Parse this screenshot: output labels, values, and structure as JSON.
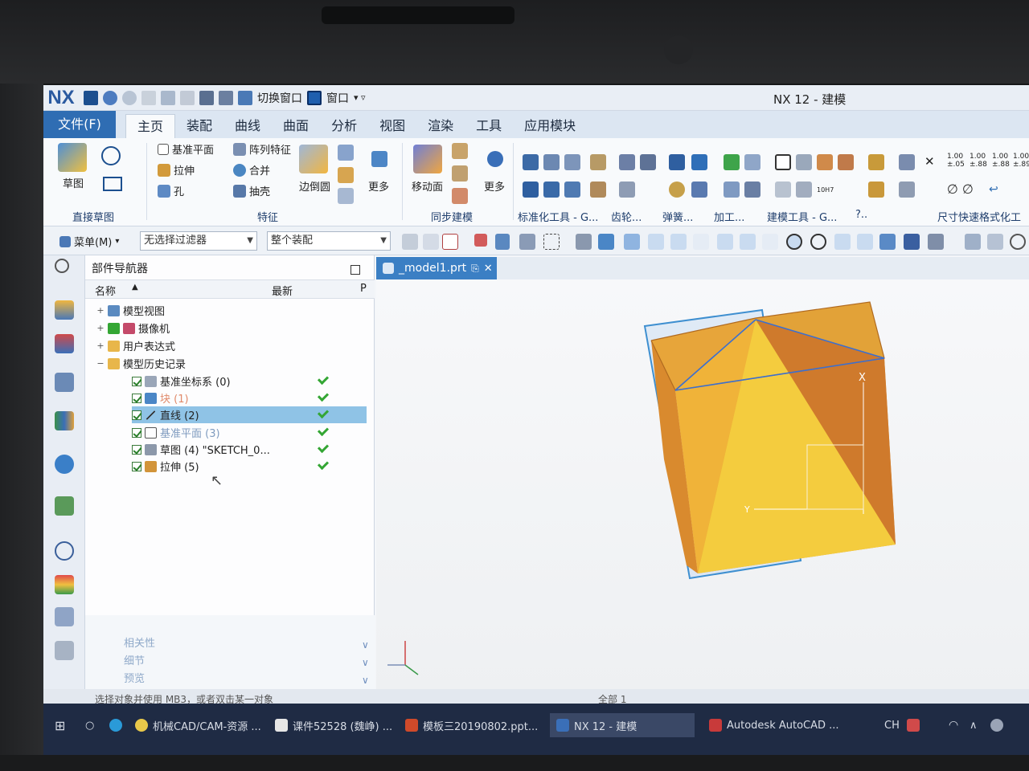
{
  "window": {
    "app_logo": "NX",
    "title": "NX 12 - 建模"
  },
  "quick_access": {
    "switch_window": "切换窗口",
    "window_menu": "窗口"
  },
  "tabs": [
    {
      "label": "文件(F)",
      "name": "tab-file"
    },
    {
      "label": "主页",
      "name": "tab-home"
    },
    {
      "label": "装配",
      "name": "tab-assembly"
    },
    {
      "label": "曲线",
      "name": "tab-curve"
    },
    {
      "label": "曲面",
      "name": "tab-surface"
    },
    {
      "label": "分析",
      "name": "tab-analysis"
    },
    {
      "label": "视图",
      "name": "tab-view"
    },
    {
      "label": "渲染",
      "name": "tab-render"
    },
    {
      "label": "工具",
      "name": "tab-tools"
    },
    {
      "label": "应用模块",
      "name": "tab-applications"
    }
  ],
  "ribbon": {
    "sketch": "草图",
    "direct_sketch_group": "直接草图",
    "datum_plane": "基准平面",
    "extrude": "拉伸",
    "hole": "孔",
    "pattern_feature": "阵列特征",
    "unite": "合并",
    "shell": "抽壳",
    "edge_blend": "边倒圆",
    "more": "更多",
    "feature_group": "特征",
    "move_face": "移动面",
    "more2": "更多",
    "sync_group": "同步建模",
    "std_tools": "标准化工具 - G...",
    "gear": "齿轮...",
    "spring": "弹簧...",
    "machining": "加工...",
    "build_tools": "建模工具 - G...",
    "q": "?..",
    "dim_format": "尺寸快速格式化工具",
    "dim_values": [
      "1.00\n±.05",
      "1.00\n±.88",
      "1.00\n±.88",
      "1.00\n±.89"
    ],
    "tol_label": "10H7"
  },
  "filterbar": {
    "menu": "菜单(M)",
    "filter": "无选择过滤器",
    "scope": "整个装配"
  },
  "navigator": {
    "title": "部件导航器",
    "col_name": "名称",
    "col_latest": "最新",
    "col_p": "P",
    "nodes": [
      {
        "label": "模型视图"
      },
      {
        "label": "摄像机"
      },
      {
        "label": "用户表达式"
      },
      {
        "label": "模型历史记录"
      },
      {
        "label": "基准坐标系 (0)"
      },
      {
        "label": "块 (1)"
      },
      {
        "label": "直线 (2)"
      },
      {
        "label": "基准平面 (3)"
      },
      {
        "label": "草图 (4) \"SKETCH_0..."
      },
      {
        "label": "拉伸 (5)"
      }
    ],
    "sections": [
      "相关性",
      "细节",
      "预览"
    ]
  },
  "graphics": {
    "tab_label": "_model1.prt"
  },
  "status": {
    "hint": "选择对象并使用 MB3，或者双击某一对象",
    "selection": "全部 1"
  },
  "taskbar": {
    "items": [
      "机械CAD/CAM-资源 ...",
      "课件52528 (魏峥) ...",
      "模板三20190802.ppt...",
      "NX 12 - 建模",
      "Autodesk AutoCAD ..."
    ],
    "lang": "CH"
  },
  "colors": {
    "accent": "#2f6db3",
    "selection": "#8fc3e6",
    "ok_check": "#34a634",
    "body_orange": "#e69a2e",
    "body_yellow": "#f1c23a"
  }
}
